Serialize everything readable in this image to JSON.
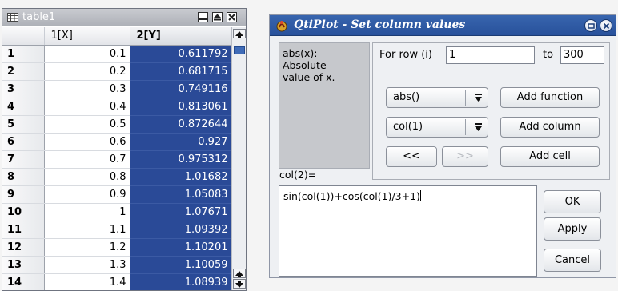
{
  "table_window": {
    "title": "table1",
    "columns": [
      "1[X]",
      "2[Y]"
    ],
    "rows": [
      {
        "n": "1",
        "x": "0.1",
        "y": "0.611792"
      },
      {
        "n": "2",
        "x": "0.2",
        "y": "0.681715"
      },
      {
        "n": "3",
        "x": "0.3",
        "y": "0.749116"
      },
      {
        "n": "4",
        "x": "0.4",
        "y": "0.813061"
      },
      {
        "n": "5",
        "x": "0.5",
        "y": "0.872644"
      },
      {
        "n": "6",
        "x": "0.6",
        "y": "0.927"
      },
      {
        "n": "7",
        "x": "0.7",
        "y": "0.975312"
      },
      {
        "n": "8",
        "x": "0.8",
        "y": "1.01682"
      },
      {
        "n": "9",
        "x": "0.9",
        "y": "1.05083"
      },
      {
        "n": "10",
        "x": "1",
        "y": "1.07671"
      },
      {
        "n": "11",
        "x": "1.1",
        "y": "1.09392"
      },
      {
        "n": "12",
        "x": "1.2",
        "y": "1.10201"
      },
      {
        "n": "13",
        "x": "1.3",
        "y": "1.10059"
      },
      {
        "n": "14",
        "x": "1.4",
        "y": "1.08939"
      }
    ],
    "selection_color": "#2a4a97"
  },
  "dialog": {
    "title": "QtiPlot - Set column values",
    "description": "abs(x):\n Absolute\nvalue of x.",
    "column_ref": "col(2)=",
    "for_row_label": "For row (i)",
    "from_value": "1",
    "to_label": "to",
    "to_value": "300",
    "function_combo": "abs()",
    "add_function": "Add function",
    "column_combo": "col(1)",
    "add_column": "Add column",
    "prev_button": "<<",
    "next_button": ">>",
    "add_cell": "Add cell",
    "formula": "sin(col(1))+cos(col(1)/3+1)",
    "ok": "OK",
    "apply": "Apply",
    "cancel": "Cancel",
    "title_bar_color": "#28519b"
  }
}
